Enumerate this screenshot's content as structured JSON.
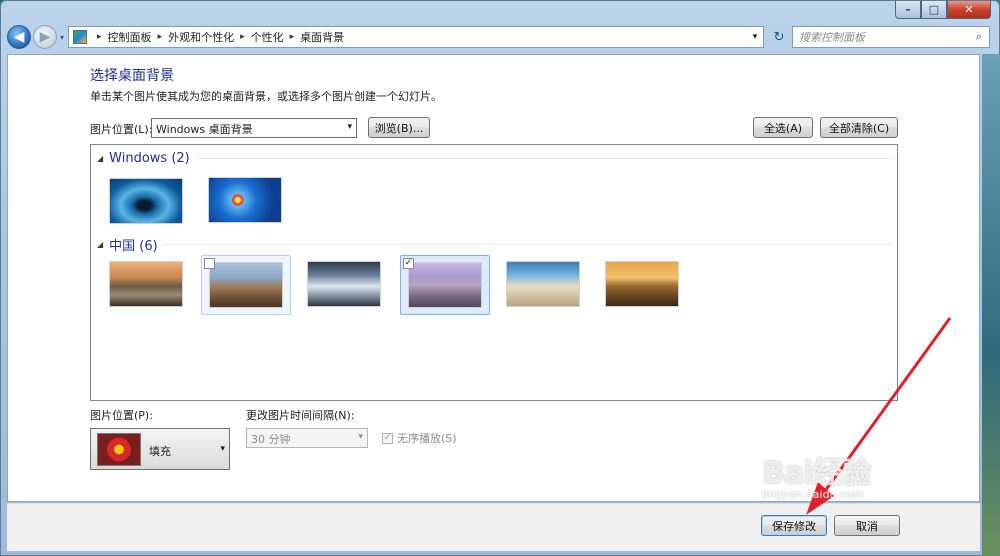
{
  "window": {
    "caption_buttons": {
      "minimize": "–",
      "maximize": "□",
      "close": "✕"
    }
  },
  "nav": {
    "back_glyph": "◀",
    "forward_glyph": "▶",
    "history_glyph": "▾",
    "breadcrumbs": [
      "控制面板",
      "外观和个性化",
      "个性化",
      "桌面背景"
    ],
    "breadcrumb_sep": "▸",
    "address_dropdown_glyph": "▾",
    "refresh_glyph": "↻",
    "search_placeholder": "搜索控制面板",
    "search_icon_glyph": "⌕"
  },
  "page": {
    "title": "选择桌面背景",
    "subtitle": "单击某个图片使其成为您的桌面背景，或选择多个图片创建一个幻灯片。",
    "location_label": "图片位置(L):",
    "location_value": "Windows 桌面背景",
    "browse_label": "浏览(B)...",
    "select_all_label": "全选(A)",
    "clear_all_label": "全部清除(C)"
  },
  "gallery": {
    "groups": [
      {
        "name": "Windows (2)",
        "collapse_glyph": "◢"
      },
      {
        "name": "中国 (6)",
        "collapse_glyph": "◢"
      }
    ],
    "checked_glyph": "✓"
  },
  "bottom": {
    "position_label": "图片位置(P):",
    "position_value": "填充",
    "interval_label": "更改图片时间间隔(N):",
    "interval_value": "30 分钟",
    "shuffle_label": "无序播放(S)",
    "shuffle_checked_glyph": "✓",
    "dropdown_glyph": "▾"
  },
  "footer": {
    "save_label": "保存修改",
    "cancel_label": "取消"
  },
  "watermark": {
    "text": "Bai经验",
    "url": "jingyan.baidu.com"
  },
  "colors": {
    "accent_title": "#1e3287",
    "selection_fill": "#dceafc",
    "selection_border": "#84acdd",
    "annotation_arrow": "#e0202a"
  },
  "icons": [
    "back-arrow-icon",
    "forward-arrow-icon",
    "control-panel-icon",
    "refresh-icon",
    "search-icon",
    "checkmark-icon",
    "dropdown-arrow-icon",
    "collapse-triangle-icon"
  ]
}
